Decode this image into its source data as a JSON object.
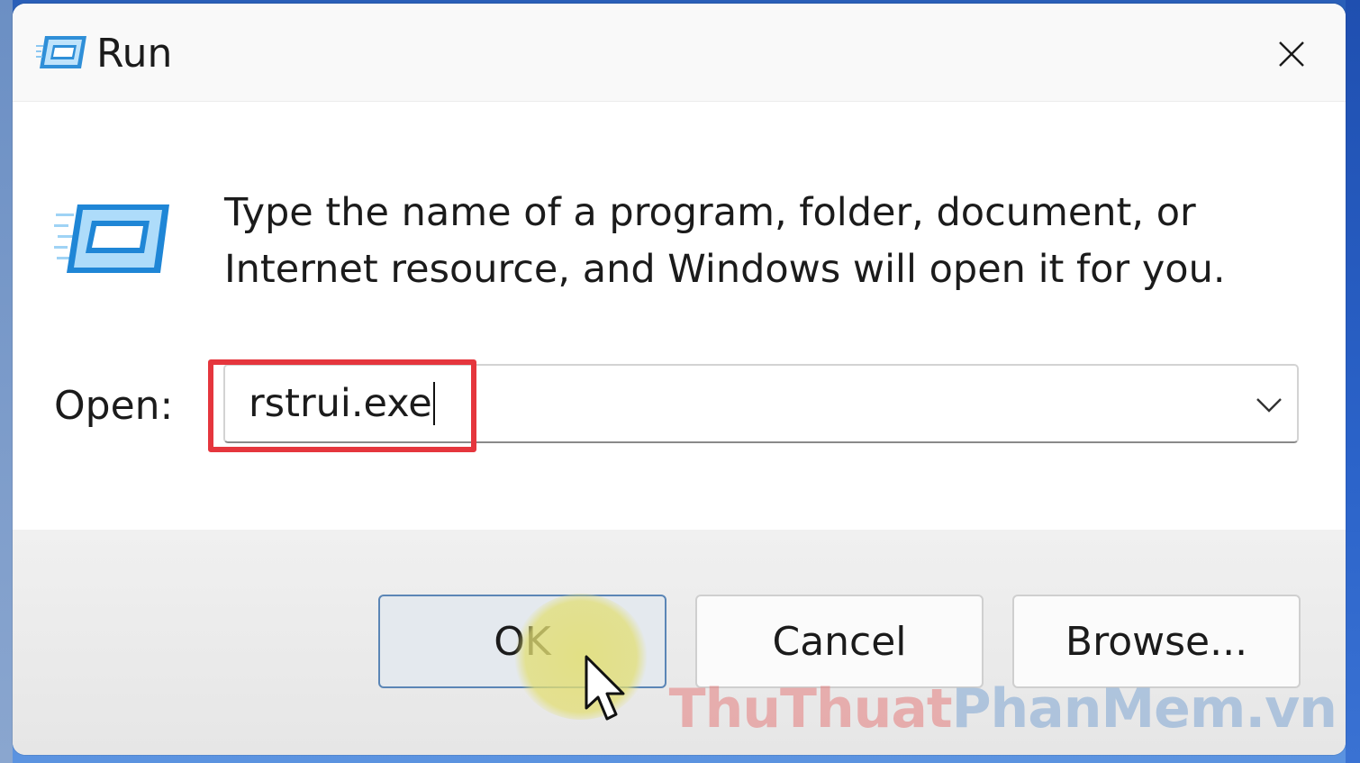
{
  "window": {
    "title": "Run",
    "title_icon": "run-icon",
    "close_icon": "close-icon"
  },
  "content": {
    "icon": "run-icon",
    "description_line1": "Type the name of a program, folder, document, or",
    "description_line2": "Internet resource, and Windows will open it for you.",
    "open_label": "Open:",
    "open_value": "rstrui.exe",
    "dropdown_icon": "chevron-down-icon"
  },
  "buttons": {
    "ok_label": "OK",
    "cancel_label": "Cancel",
    "browse_label": "Browse..."
  },
  "watermark": {
    "part1": "ThuThuat",
    "part2": "PhanMem",
    "part3": ".vn"
  },
  "colors": {
    "highlight": "#e5363d",
    "ok_border": "#5b86b6",
    "icon_blue": "#3aa0e8"
  }
}
